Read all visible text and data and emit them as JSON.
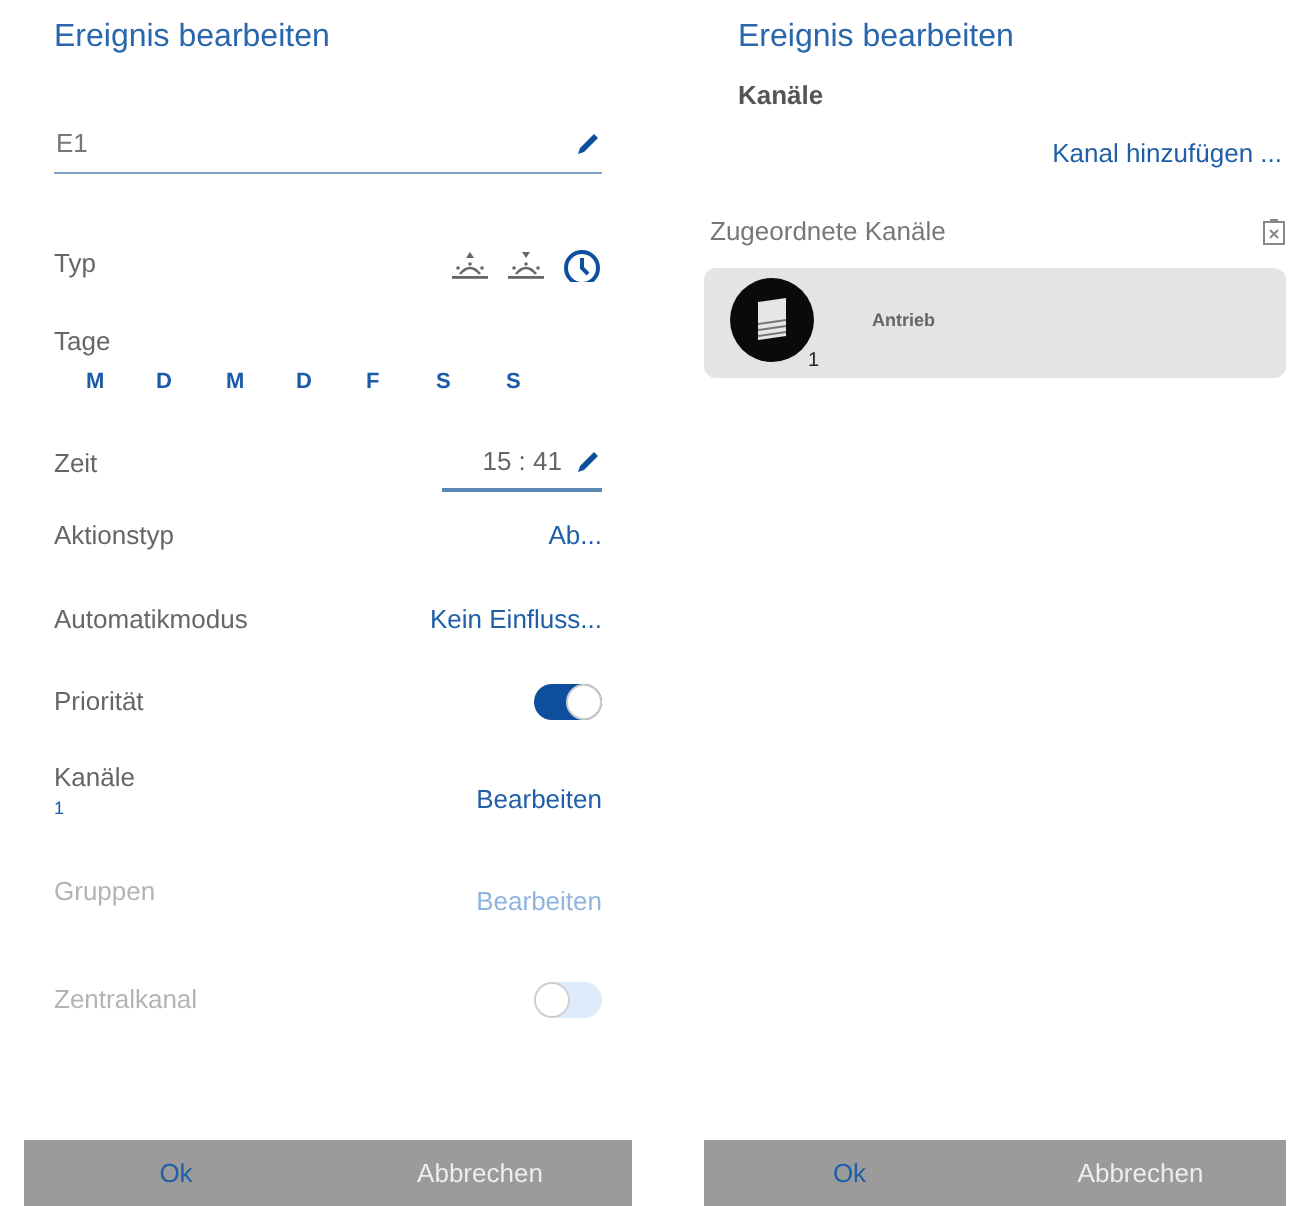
{
  "edit_panel": {
    "title": "Ereignis bearbeiten",
    "name_field": {
      "value": "E1"
    },
    "type": {
      "label": "Typ",
      "options": [
        {
          "kind": "sunrise",
          "selected": false
        },
        {
          "kind": "sunset",
          "selected": false
        },
        {
          "kind": "clock",
          "selected": true
        }
      ]
    },
    "days": {
      "label": "Tage",
      "items": [
        {
          "label": "M",
          "selected": true
        },
        {
          "label": "D",
          "selected": true
        },
        {
          "label": "M",
          "selected": true
        },
        {
          "label": "D",
          "selected": true
        },
        {
          "label": "F",
          "selected": true
        },
        {
          "label": "S",
          "selected": true
        },
        {
          "label": "S",
          "selected": true
        }
      ]
    },
    "time": {
      "label": "Zeit",
      "value": "15 : 41"
    },
    "rows": [
      {
        "kind": "link",
        "label": "Aktionstyp",
        "value": "Ab...",
        "disabled": false
      },
      {
        "kind": "link",
        "label": "Automatikmodus",
        "value": "Kein Einfluss...",
        "disabled": false
      },
      {
        "kind": "toggle",
        "label": "Priorität",
        "on": true,
        "disabled": false
      },
      {
        "kind": "edit",
        "label": "Kanäle",
        "count": "1",
        "value": "Bearbeiten",
        "disabled": false
      },
      {
        "kind": "edit",
        "label": "Gruppen",
        "value": "Bearbeiten",
        "disabled": true
      },
      {
        "kind": "toggle",
        "label": "Zentralkanal",
        "on": false,
        "disabled": true
      }
    ],
    "buttons": [
      "Ok",
      "Abbrechen"
    ]
  },
  "channels_panel": {
    "title": "Ereignis bearbeiten",
    "section": "Kanäle",
    "add_link": "Kanal hinzufügen ...",
    "assigned_label": "Zugeordnete Kanäle",
    "channels": [
      {
        "name": "Antrieb",
        "number": "1"
      }
    ],
    "buttons": [
      "Ok",
      "Abbrechen"
    ]
  }
}
